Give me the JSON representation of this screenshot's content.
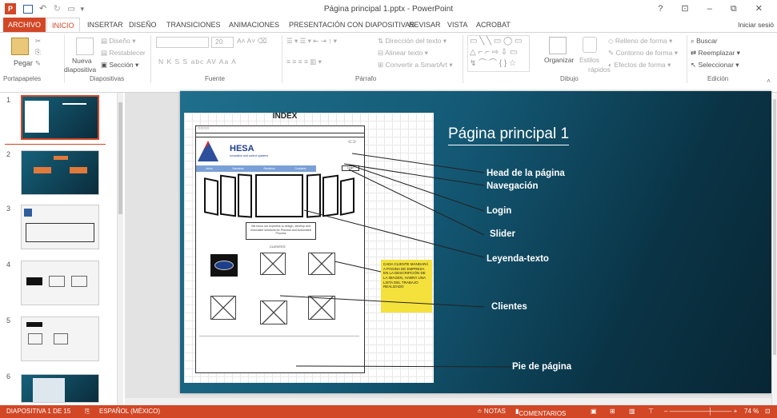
{
  "window": {
    "title": "Página principal 1.pptx - PowerPoint",
    "controls": "? ⊡ – ⧉ ✕",
    "sign_in": "Iniciar sesió"
  },
  "quick_access": [
    "save-icon",
    "undo-icon",
    "redo-icon",
    "present-icon"
  ],
  "tabs": [
    {
      "label": "ARCHIVO",
      "state": "file"
    },
    {
      "label": "INICIO",
      "state": "active"
    },
    {
      "label": "INSERTAR",
      "state": ""
    },
    {
      "label": "DISEÑO",
      "state": ""
    },
    {
      "label": "TRANSICIONES",
      "state": ""
    },
    {
      "label": "ANIMACIONES",
      "state": ""
    },
    {
      "label": "PRESENTACIÓN CON DIAPOSITIVAS",
      "state": ""
    },
    {
      "label": "REVISAR",
      "state": ""
    },
    {
      "label": "VISTA",
      "state": ""
    },
    {
      "label": "ACROBAT",
      "state": ""
    }
  ],
  "ribbon": {
    "clipboard": {
      "paste": "Pegar",
      "label": "Portapapeles"
    },
    "slides": {
      "new_slide": "Nueva",
      "new_slide2": "diapositiva",
      "layout": "Diseño",
      "reset": "Restablecer",
      "section": "Sección",
      "label": "Diapositivas"
    },
    "font": {
      "size": "20",
      "format": "N  K  S  S  abc  AV  Aa  A",
      "label": "Fuente"
    },
    "paragraph": {
      "direction": "Dirección del texto",
      "align": "Alinear texto",
      "smartart": "Convertir a SmartArt",
      "label": "Párrafo"
    },
    "drawing": {
      "arrange": "Organizar",
      "styles": "Estilos",
      "styles2": "rápidos",
      "fill": "Relleno de forma",
      "outline": "Contorno de forma",
      "effects": "Efectos de forma",
      "label": "Dibujo"
    },
    "editing": {
      "find": "Buscar",
      "replace": "Reemplazar",
      "select": "Seleccionar",
      "label": "Edición"
    }
  },
  "thumbnails": [
    {
      "num": "1",
      "style": "dark sel"
    },
    {
      "num": "2",
      "style": "dark"
    },
    {
      "num": "3",
      "style": "light"
    },
    {
      "num": "4",
      "style": "light"
    },
    {
      "num": "5",
      "style": "light"
    },
    {
      "num": "6",
      "style": "dark"
    }
  ],
  "slide": {
    "title": "Página principal 1",
    "mockup": {
      "index": "INDEX",
      "logo": "HESA",
      "logo_sub": "Innovative and control systems",
      "nav": [
        "Inicio",
        "Nosotros",
        "Servicios",
        "Contacto",
        "Login"
      ],
      "tagline": "We focus our expertise to design, develop and innovative solutions for Process and Automated Process",
      "clients_label": "CLIENTES",
      "note": "CADA CLIENTE MANDARÁ A PÁGINA DE EMPRESA EN LA DESCRIPCIÓN DE LA IMAGEN, HABRÁ UNA LISTA DEL TRABAJO REALIZADO"
    },
    "labels": [
      "Head de la página",
      "Navegación",
      "Login",
      "Slider",
      "Leyenda-texto",
      "Clientes",
      "Pie de página"
    ]
  },
  "status": {
    "slide_info": "DIAPOSITIVA 1 DE 15",
    "language": "ESPAÑOL (MÉXICO)",
    "notes": "≐ NOTAS",
    "comments": "COMENTARIOS",
    "zoom": "74 %"
  },
  "colors": {
    "accent": "#d24726",
    "slide_bg": "#145a76",
    "note": "#f5e13b"
  }
}
